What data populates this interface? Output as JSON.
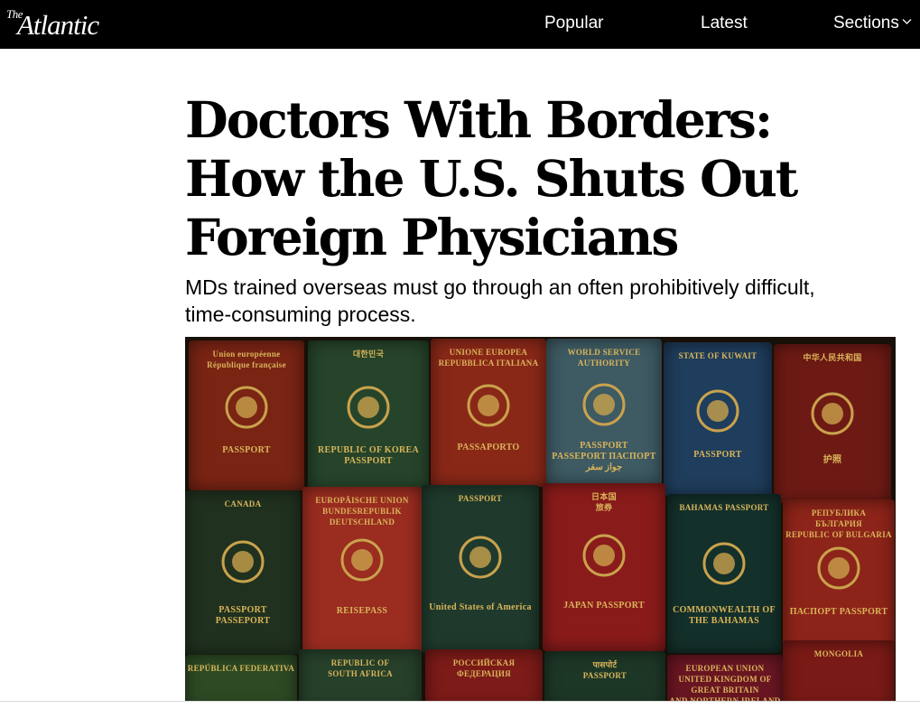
{
  "header": {
    "logo_the": "The",
    "logo_name": "Atlantic",
    "nav": [
      {
        "label": "Popular"
      },
      {
        "label": "Latest"
      },
      {
        "label": "Sections"
      }
    ]
  },
  "article": {
    "headline_lines": [
      "Doctors With Borders:",
      "How the U.S. Shuts Out",
      "Foreign Physicians"
    ],
    "subheadline_lines": [
      "MDs trained overseas must go through an often prohibitively difficult,",
      "time-consuming process."
    ]
  },
  "hero_image": {
    "passports": [
      {
        "id": "eu-france",
        "lines": [
          "Union européenne",
          "République française"
        ],
        "footer": "PASSPORT",
        "color": "#7a2414"
      },
      {
        "id": "korea",
        "lines": [
          "대한민국"
        ],
        "footer": "REPUBLIC OF KOREA PASSPORT",
        "color": "#26442a"
      },
      {
        "id": "italy",
        "lines": [
          "UNIONE EUROPEA",
          "REPUBBLICA ITALIANA"
        ],
        "footer": "PASSAPORTO",
        "color": "#8a2818"
      },
      {
        "id": "wsa",
        "lines": [
          "WORLD SERVICE",
          "AUTHORITY"
        ],
        "footer": "PASSPORT PASSEPORT ПАСПОРТ جواز سفر",
        "color": "#3e5a63"
      },
      {
        "id": "kuwait",
        "lines": [
          "STATE OF KUWAIT"
        ],
        "footer": "PASSPORT",
        "color": "#1f3d5c"
      },
      {
        "id": "china",
        "lines": [
          "中华人民共和国"
        ],
        "footer": "护照",
        "color": "#6e1a14"
      },
      {
        "id": "canada",
        "lines": [
          "CANADA"
        ],
        "footer": "PASSPORT PASSEPORT",
        "color": "#20311f"
      },
      {
        "id": "germany",
        "lines": [
          "EUROPÄISCHE UNION",
          "BUNDESREPUBLIK",
          "DEUTSCHLAND"
        ],
        "footer": "REISEPASS",
        "color": "#9a2c20"
      },
      {
        "id": "usa",
        "lines": [
          "PASSPORT"
        ],
        "footer": "United States of America",
        "color": "#1f3a2c"
      },
      {
        "id": "japan",
        "lines": [
          "日本国",
          "旅券"
        ],
        "footer": "JAPAN PASSPORT",
        "color": "#8a1b1b"
      },
      {
        "id": "bahamas",
        "lines": [
          "BAHAMAS PASSPORT"
        ],
        "footer": "COMMONWEALTH OF THE BAHAMAS",
        "color": "#14302a"
      },
      {
        "id": "bulgaria",
        "lines": [
          "РЕПУБЛИКА",
          "БЪЛГАРИЯ",
          "REPUBLIC OF BULGARIA"
        ],
        "footer": "ПАСПОРТ PASSPORT",
        "color": "#8d2419"
      },
      {
        "id": "brazil",
        "lines": [
          "REPÚBLICA FEDERATIVA"
        ],
        "footer": "",
        "color": "#2d4a24"
      },
      {
        "id": "south-africa",
        "lines": [
          "REPUBLIC OF",
          "SOUTH AFRICA"
        ],
        "footer": "",
        "color": "#26402a"
      },
      {
        "id": "russia",
        "lines": [
          "РОССИЙСКАЯ",
          "ФЕДЕРАЦИЯ"
        ],
        "footer": "",
        "color": "#7c1b18"
      },
      {
        "id": "india",
        "lines": [
          "पासपोर्ट",
          "PASSPORT"
        ],
        "footer": "",
        "color": "#1d3727"
      },
      {
        "id": "uk",
        "lines": [
          "EUROPEAN UNION",
          "UNITED KINGDOM OF",
          "GREAT BRITAIN",
          "AND NORTHERN IRELAND"
        ],
        "footer": "",
        "color": "#6a1622"
      },
      {
        "id": "mongolia",
        "lines": [
          "MONGOLIA"
        ],
        "footer": "",
        "color": "#7a1a16"
      }
    ]
  }
}
